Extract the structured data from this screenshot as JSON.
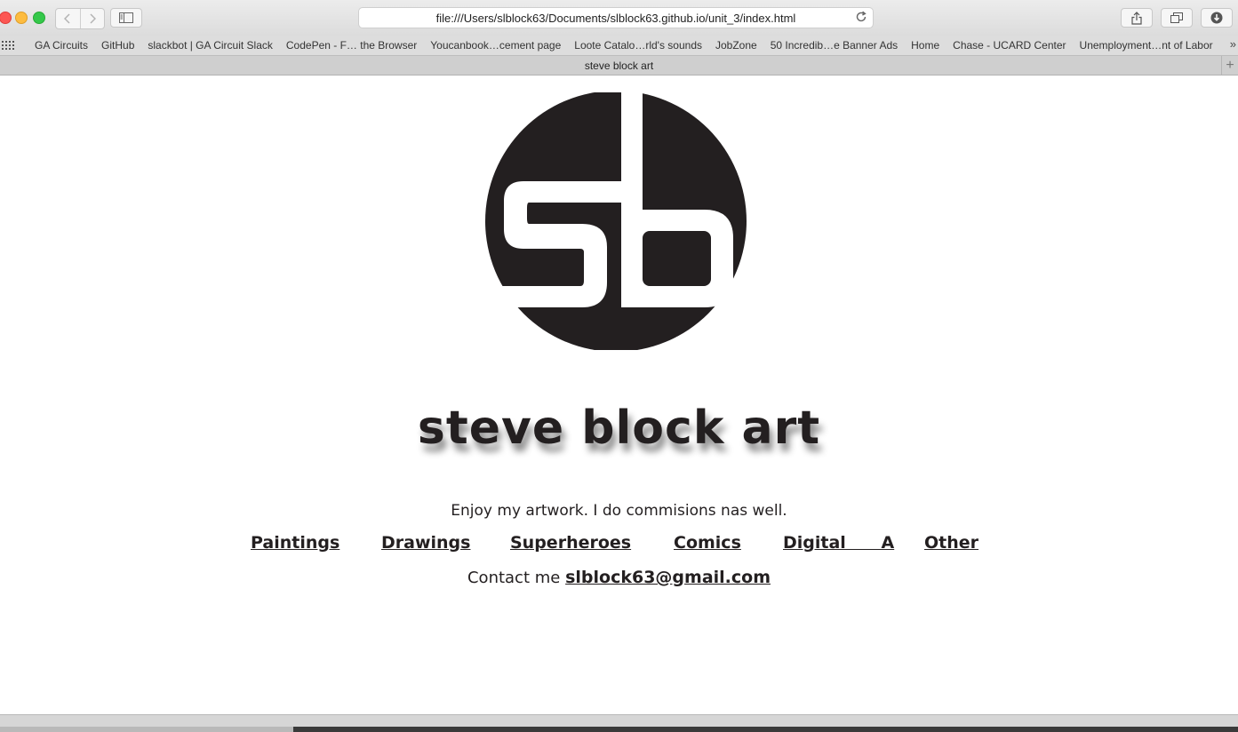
{
  "browser": {
    "url": "file:///Users/slblock63/Documents/slblock63.github.io/unit_3/index.html",
    "tab_title": "steve block art",
    "bookmarks": [
      "GA Circuits",
      "GitHub",
      "slackbot | GA Circuit Slack",
      "CodePen - F… the Browser",
      "Youcanbook…cement page",
      "Loote Catalo…rld's sounds",
      "JobZone",
      "50 Incredib…e Banner Ads",
      "Home",
      "Chase - UCARD Center",
      "Unemployment…nt of Labor"
    ],
    "more_bookmarks": "»",
    "new_tab": "+"
  },
  "page": {
    "logo_text": "sb",
    "title": "steve block art",
    "tagline": "Enjoy my artwork. I do commisions nas well.",
    "nav": {
      "paintings": "Paintings",
      "drawings": "Drawings",
      "superheroes": "Superheroes",
      "comics": "Comics",
      "digital": "Digital      A",
      "other": "Other"
    },
    "contact_prefix": "Contact me",
    "contact_email": "slblock63@gmail.com"
  },
  "colors": {
    "ink": "#231f20",
    "chrome": "#dcdcdc"
  }
}
